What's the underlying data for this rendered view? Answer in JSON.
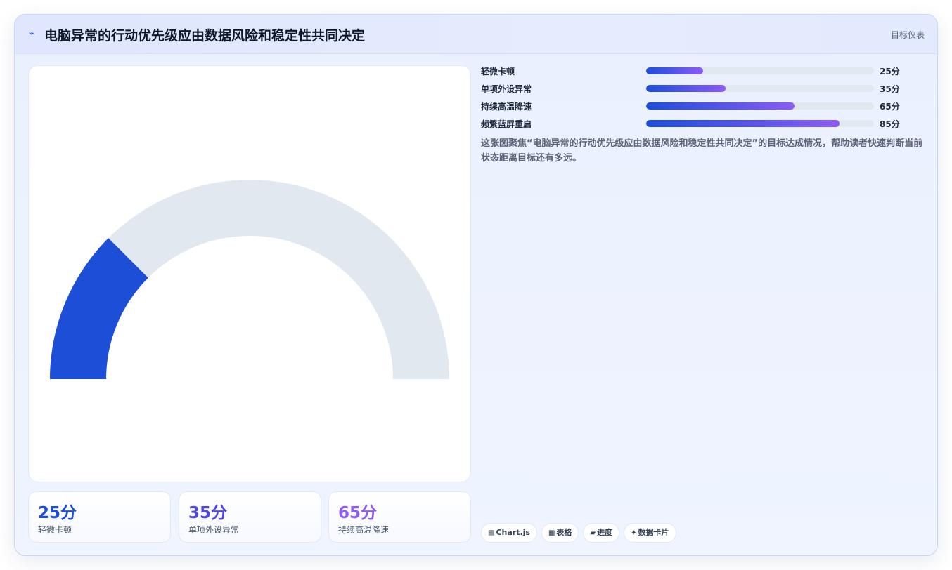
{
  "header": {
    "title": "电脑异常的行动优先级应由数据风险和稳定性共同决定",
    "tag": "目标仪表",
    "icon": "bolt-icon"
  },
  "colors": {
    "accent": "#1d4ed8",
    "accent_end": "#8b5cf6",
    "track": "#e2e8f0",
    "stat_colors": [
      "#1d4ed8",
      "#4f46e5",
      "#8b5cf6"
    ]
  },
  "chart_data": {
    "type": "gauge",
    "value": 25,
    "range": [
      0,
      100
    ],
    "series": [
      {
        "label": "轻微卡顿",
        "value": 25,
        "display": "25分"
      },
      {
        "label": "单项外设异常",
        "value": 35,
        "display": "35分"
      },
      {
        "label": "持续高温降速",
        "value": 65,
        "display": "65分"
      },
      {
        "label": "频繁蓝屏重启",
        "value": 85,
        "display": "85分"
      }
    ]
  },
  "stats": [
    {
      "value": "25分",
      "label": "轻微卡顿"
    },
    {
      "value": "35分",
      "label": "单项外设异常"
    },
    {
      "value": "65分",
      "label": "持续高温降速"
    }
  ],
  "description": "这张图聚焦“电脑异常的行动优先级应由数据风险和稳定性共同决定”的目标达成情况，帮助读者快速判断当前状态距离目标还有多远。",
  "chips": [
    {
      "icon": "▤",
      "label": "Chart.js",
      "icon_name": "chart-icon"
    },
    {
      "icon": "▦",
      "label": "表格",
      "icon_name": "table-icon"
    },
    {
      "icon": "▰",
      "label": "进度",
      "icon_name": "progress-icon"
    },
    {
      "icon": "✦",
      "label": "数据卡片",
      "icon_name": "sparkle-icon"
    }
  ]
}
